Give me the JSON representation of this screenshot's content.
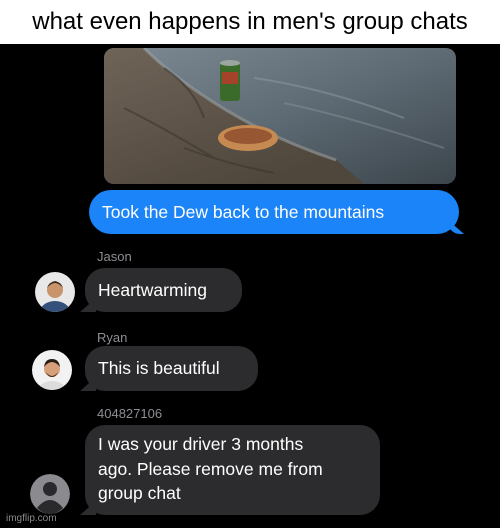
{
  "caption": "what even happens in men's group chats",
  "sent_message": "Took the Dew back to the mountains",
  "messages": [
    {
      "sender": "Jason",
      "text": "Heartwarming"
    },
    {
      "sender": "Ryan",
      "text": "This is beautiful"
    },
    {
      "sender": "404827106",
      "lines": [
        "I was your driver 3 months",
        "ago. Please remove me from",
        "group chat"
      ]
    }
  ],
  "watermark": "imgflip.com",
  "colors": {
    "outgoing_bubble": "#1b84f8",
    "incoming_bubble": "#2c2c2e",
    "sender_label": "#8e8e93",
    "background": "#000000"
  },
  "icons": [
    "person-placeholder-icon"
  ]
}
